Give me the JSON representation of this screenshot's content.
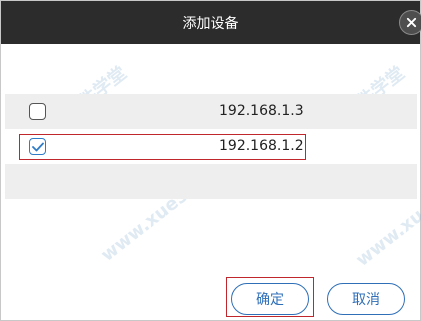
{
  "dialog": {
    "title": "添加设备",
    "close_icon": "close-icon"
  },
  "devices": [
    {
      "ip": "192.168.1.3",
      "checked": false
    },
    {
      "ip": "192.168.1.2",
      "checked": true
    }
  ],
  "buttons": {
    "confirm_label": "确定",
    "cancel_label": "取消"
  },
  "watermark": {
    "text_cn": "软件学堂",
    "text_url": "www.xue51.com"
  },
  "colors": {
    "titlebar": "#2c2c2c",
    "accent": "#2f6fb8",
    "highlight": "#c0272d",
    "row_alt": "#eeeeee"
  }
}
